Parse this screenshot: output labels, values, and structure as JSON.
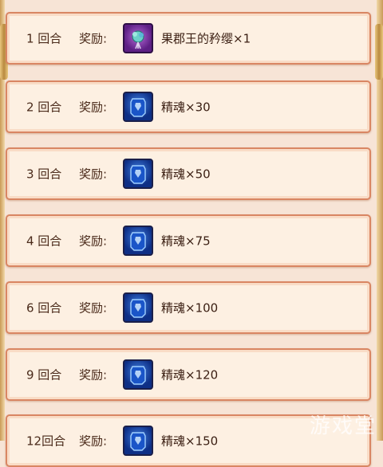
{
  "rewards": [
    {
      "round": "1 回合",
      "label": "奖励:",
      "item": "果郡王的矜缨×1",
      "icon": "tassel-item-icon"
    },
    {
      "round": "2 回合",
      "label": "奖励:",
      "item": "精魂×30",
      "icon": "soul-crystal-icon"
    },
    {
      "round": "3 回合",
      "label": "奖励:",
      "item": "精魂×50",
      "icon": "soul-crystal-icon"
    },
    {
      "round": "4 回合",
      "label": "奖励:",
      "item": "精魂×75",
      "icon": "soul-crystal-icon"
    },
    {
      "round": "6 回合",
      "label": "奖励:",
      "item": "精魂×100",
      "icon": "soul-crystal-icon"
    },
    {
      "round": "9 回合",
      "label": "奖励:",
      "item": "精魂×120",
      "icon": "soul-crystal-icon"
    },
    {
      "round": "12回合",
      "label": "奖励:",
      "item": "精魂×150",
      "icon": "soul-crystal-icon"
    }
  ],
  "watermark": "游戏堂",
  "colors": {
    "row_border": "#d98663",
    "row_bg": "#fdf0e2",
    "page_bg": "#f7e4d6",
    "text": "#4a2a1a"
  }
}
